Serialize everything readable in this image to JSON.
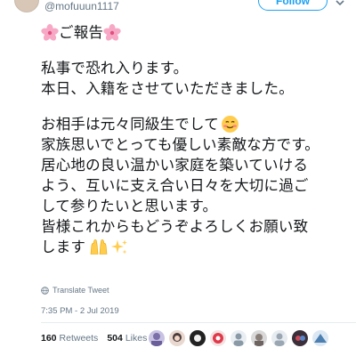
{
  "header": {
    "handle": "@mofuuun1117",
    "follow_label": "Follow"
  },
  "tweet": {
    "title_line": "ご報告",
    "lines": [
      "私事で恐れ入ります。",
      "本日、入籍をさせていただきました。",
      "お相手は元々同級生でして",
      "家族思いでとっても優しい素敵な方です。",
      "居心地の良い温かい家庭を築いていける",
      "よう、互いに支え合い日々を大切に過ご",
      "して参りたいと思います。",
      "皆様これからもどうぞよろしくお願い致",
      "します"
    ],
    "emojis": [
      "cherry-blossom",
      "smiling-face",
      "raising-hands",
      "sparkles"
    ]
  },
  "translate_label": "Translate Tweet",
  "timestamp": "7:35 PM - 2 Jul 2019",
  "stats": {
    "retweets_count": "160",
    "retweets_label": "Retweets",
    "likes_count": "504",
    "likes_label": "Likes"
  },
  "colors": {
    "accent": "#1da1f2",
    "text": "#14171a",
    "muted": "#657786",
    "divider": "#e6ecf0"
  }
}
